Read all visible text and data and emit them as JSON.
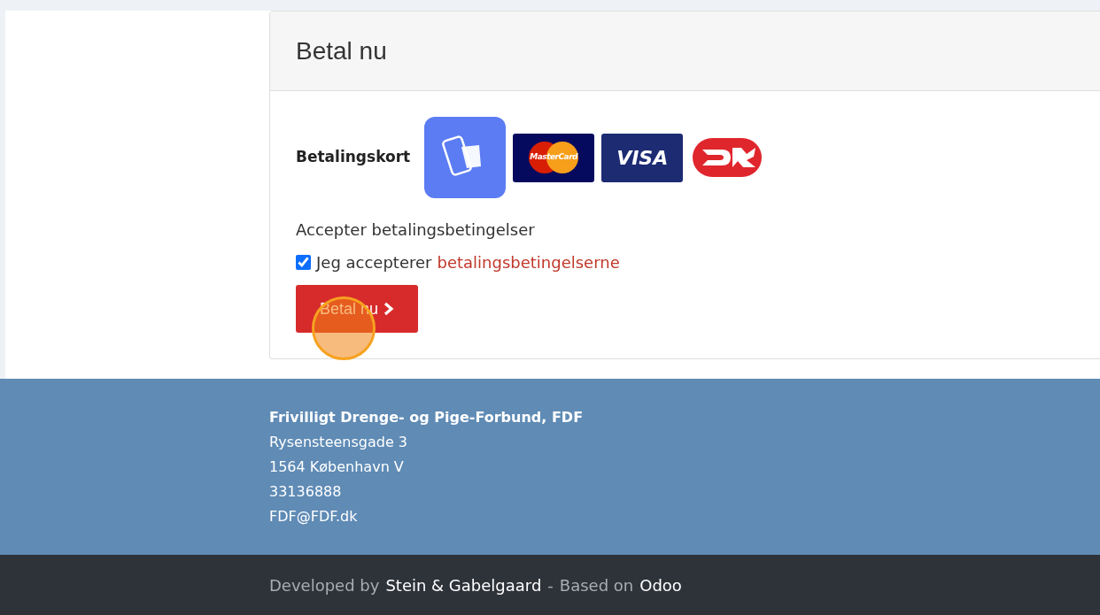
{
  "card": {
    "title": "Betal nu",
    "payment_label": "Betalingskort",
    "payment_options": [
      {
        "kind": "app",
        "selected": true
      },
      {
        "kind": "mastercard",
        "text": "MasterCard",
        "selected": false
      },
      {
        "kind": "visa",
        "text": "VISA",
        "selected": false
      },
      {
        "kind": "dankort",
        "selected": false
      }
    ],
    "terms_heading": "Accepter betalingsbetingelser",
    "terms_checkbox": {
      "label": "Jeg accepterer",
      "link": "betalingsbetingelserne",
      "checked": true
    },
    "pay_button": {
      "label": "Betal nu",
      "clicked": true
    }
  },
  "footer": {
    "lines": [
      {
        "text": "Frivilligt Drenge- og Pige-Forbund, FDF",
        "bold": true
      },
      {
        "text": "Rysensteensgade 3",
        "bold": false
      },
      {
        "text": "1564 København V",
        "bold": false
      },
      {
        "text": "33136888",
        "bold": false
      },
      {
        "text": "FDF@FDF.dk",
        "bold": false
      }
    ]
  },
  "credits": [
    {
      "text": "Developed by",
      "link": false
    },
    {
      "text": "Stein & Gabelgaard",
      "link": true
    },
    {
      "text": "-",
      "link": false
    },
    {
      "text": "Based on",
      "link": false
    },
    {
      "text": "Odoo",
      "link": true
    }
  ]
}
